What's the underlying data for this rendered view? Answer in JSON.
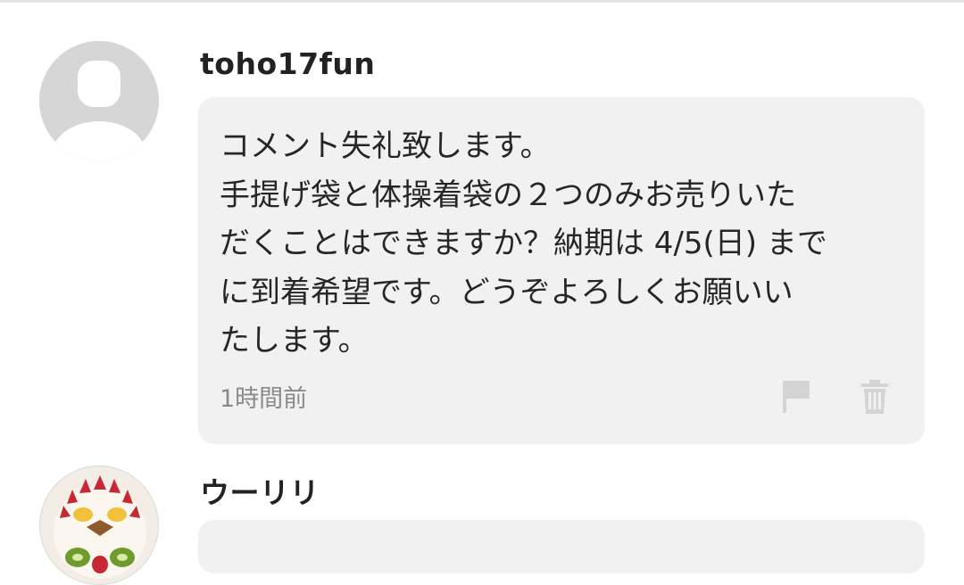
{
  "comments": [
    {
      "username": "toho17fun",
      "text": "コメント失礼致します。\n手提げ袋と体操着袋の２つのみお売りいた\nだくことはできますか？納期は 4/5(日) まで\nに到着希望です。どうぞよろしくお願いい\nたします。",
      "timestamp": "1時間前",
      "icons": [
        "flag-icon",
        "trash-icon"
      ],
      "avatar": "default-user-avatar"
    },
    {
      "username": "ウーリリ",
      "avatar": "decorated-cake-avatar"
    }
  ],
  "colors": {
    "bubble": "#f1f1f1",
    "icon": "#d4d4d4",
    "timestamp": "#8a8a8a",
    "username": "#222222"
  }
}
